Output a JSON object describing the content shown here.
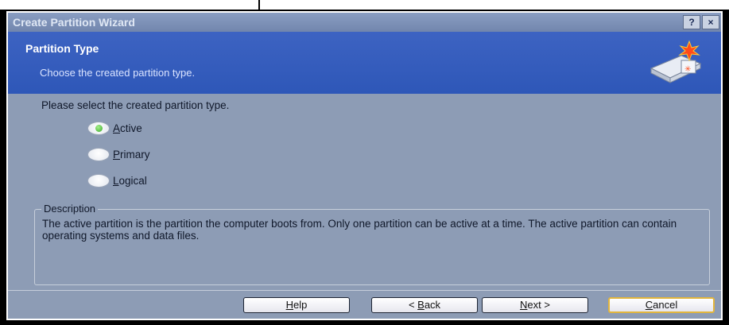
{
  "window": {
    "title": "Create Partition Wizard",
    "help_btn": "?",
    "close_btn": "×"
  },
  "header": {
    "title": "Partition Type",
    "subtitle": "Choose the created partition type.",
    "icon": "disk-star-icon"
  },
  "prompt": "Please select the created partition type.",
  "options": [
    {
      "mnemonic": "A",
      "rest": "ctive",
      "checked": true
    },
    {
      "mnemonic": "P",
      "rest": "rimary",
      "checked": false
    },
    {
      "mnemonic": "L",
      "rest": "ogical",
      "checked": false
    }
  ],
  "description": {
    "legend": "Description",
    "text": "The active partition is the partition the computer boots from. Only one partition can be active at a time. The active partition can contain operating systems and data files."
  },
  "buttons": {
    "help": {
      "mnemonic": "H",
      "rest": "elp"
    },
    "back": {
      "prefix": "< ",
      "mnemonic": "B",
      "rest": "ack"
    },
    "next": {
      "mnemonic": "N",
      "rest": "ext >"
    },
    "cancel": {
      "mnemonic": "C",
      "rest": "ancel"
    }
  },
  "colors": {
    "header_blue": "#3060be",
    "dialog_bg": "#8d9cb5",
    "radio_checked": "#39a82a",
    "cancel_focus": "#e2b53d"
  }
}
